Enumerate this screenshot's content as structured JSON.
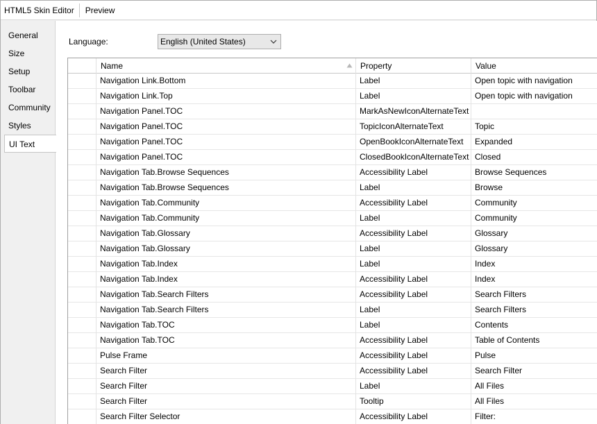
{
  "window": {
    "tabs": [
      {
        "label": "HTML5 Skin Editor"
      },
      {
        "label": "Preview"
      }
    ]
  },
  "sidebar": {
    "items": [
      {
        "label": "General"
      },
      {
        "label": "Size"
      },
      {
        "label": "Setup"
      },
      {
        "label": "Toolbar"
      },
      {
        "label": "Community"
      },
      {
        "label": "Styles"
      },
      {
        "label": "UI Text",
        "active": true
      }
    ]
  },
  "language": {
    "label": "Language:",
    "selected": "English (United States)"
  },
  "table": {
    "columns": [
      "",
      "Name",
      "Property",
      "Value"
    ],
    "sorted_column": "Name",
    "rows": [
      [
        "Navigation Link.Bottom",
        "Label",
        "Open topic with navigation"
      ],
      [
        "Navigation Link.Top",
        "Label",
        "Open topic with navigation"
      ],
      [
        "Navigation Panel.TOC",
        "MarkAsNewIconAlternateText",
        ""
      ],
      [
        "Navigation Panel.TOC",
        "TopicIconAlternateText",
        "Topic"
      ],
      [
        "Navigation Panel.TOC",
        "OpenBookIconAlternateText",
        "Expanded"
      ],
      [
        "Navigation Panel.TOC",
        "ClosedBookIconAlternateText",
        "Closed"
      ],
      [
        "Navigation Tab.Browse Sequences",
        "Accessibility Label",
        "Browse Sequences"
      ],
      [
        "Navigation Tab.Browse Sequences",
        "Label",
        "Browse"
      ],
      [
        "Navigation Tab.Community",
        "Accessibility Label",
        "Community"
      ],
      [
        "Navigation Tab.Community",
        "Label",
        "Community"
      ],
      [
        "Navigation Tab.Glossary",
        "Accessibility Label",
        "Glossary"
      ],
      [
        "Navigation Tab.Glossary",
        "Label",
        "Glossary"
      ],
      [
        "Navigation Tab.Index",
        "Label",
        "Index"
      ],
      [
        "Navigation Tab.Index",
        "Accessibility Label",
        "Index"
      ],
      [
        "Navigation Tab.Search Filters",
        "Accessibility Label",
        "Search Filters"
      ],
      [
        "Navigation Tab.Search Filters",
        "Label",
        "Search Filters"
      ],
      [
        "Navigation Tab.TOC",
        "Label",
        "Contents"
      ],
      [
        "Navigation Tab.TOC",
        "Accessibility Label",
        "Table of Contents"
      ],
      [
        "Pulse Frame",
        "Accessibility Label",
        "Pulse"
      ],
      [
        "Search Filter",
        "Accessibility Label",
        "Search Filter"
      ],
      [
        "Search Filter",
        "Label",
        "All Files"
      ],
      [
        "Search Filter",
        "Tooltip",
        "All Files"
      ],
      [
        "Search Filter Selector",
        "Accessibility Label",
        "Filter:"
      ]
    ]
  }
}
